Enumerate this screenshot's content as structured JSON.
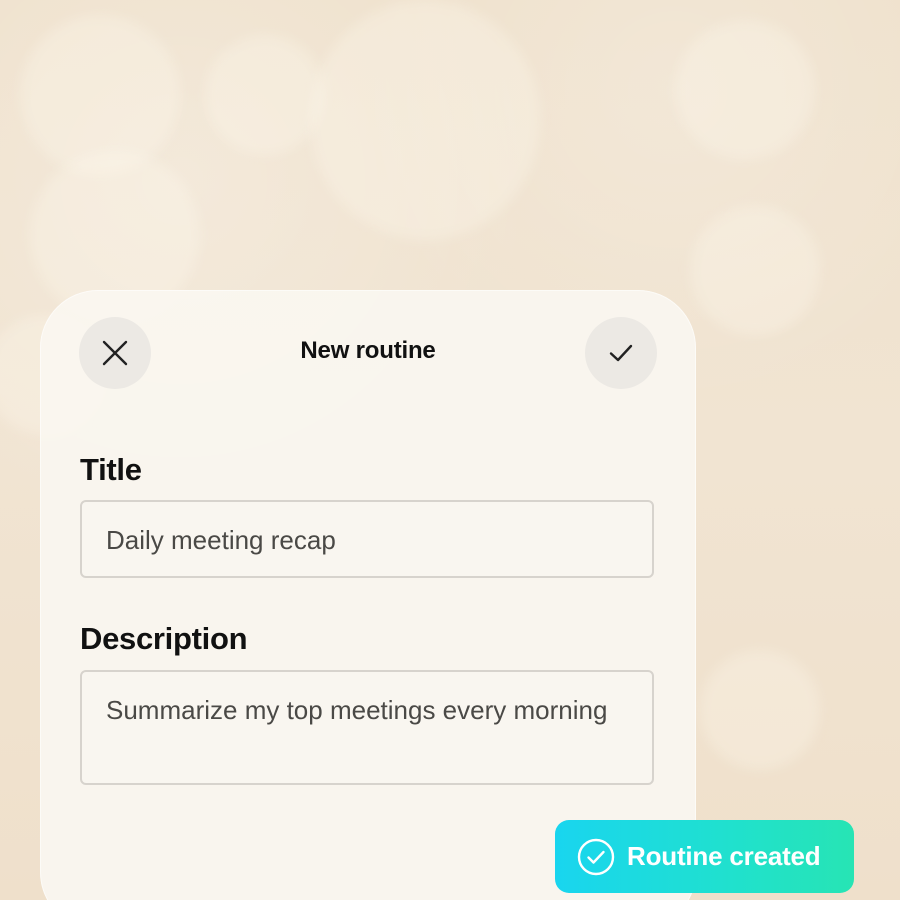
{
  "dialog": {
    "title": "New routine",
    "close_icon": "close-icon",
    "confirm_icon": "check-icon"
  },
  "fields": {
    "title_label": "Title",
    "title_value": "Daily meeting recap",
    "description_label": "Description",
    "description_value": "Summarize my top meetings every morning"
  },
  "toast": {
    "icon": "check-circle-icon",
    "text": "Routine created"
  },
  "colors": {
    "background": "#efe2cf",
    "card": "#faf6f0",
    "toast_start": "#19d5ef",
    "toast_end": "#27e4b4"
  }
}
